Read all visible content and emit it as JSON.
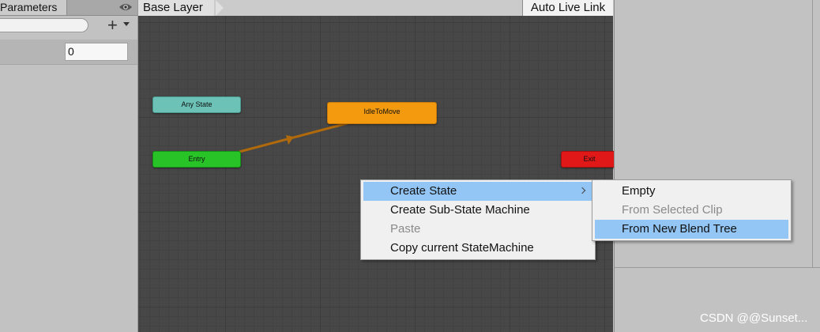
{
  "parameters_panel": {
    "tab_label": "Parameters",
    "search_placeholder": "",
    "param_value": "0"
  },
  "graph": {
    "breadcrumb": "Base Layer",
    "live_link_label": "Auto Live Link",
    "nodes": {
      "any_state": "Any State",
      "idle": "IdleToMove",
      "entry": "Entry",
      "exit": "Exit"
    },
    "colors": {
      "any_state": "#6cc2b6",
      "entry": "#27c327",
      "idle": "#f39a0e",
      "exit": "#e01818",
      "transition": "#b06a0c"
    }
  },
  "context_menu": {
    "items": [
      {
        "label": "Create State",
        "highlighted": true,
        "has_submenu": true
      },
      {
        "label": "Create Sub-State Machine"
      },
      {
        "label": "Paste",
        "disabled": true
      },
      {
        "label": "Copy current StateMachine"
      }
    ],
    "submenu": [
      {
        "label": "Empty"
      },
      {
        "label": "From Selected Clip",
        "disabled": true
      },
      {
        "label": "From New Blend Tree",
        "highlighted": true
      }
    ]
  },
  "watermark": "CSDN @@Sunset..."
}
